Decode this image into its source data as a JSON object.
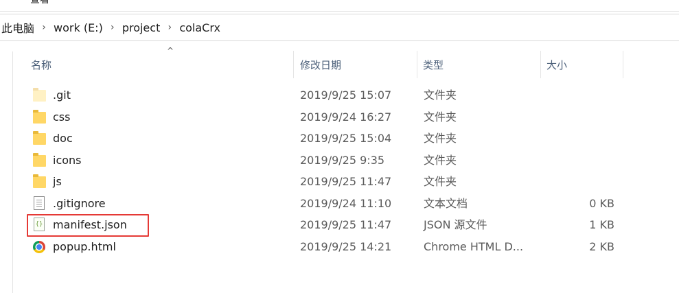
{
  "ribbon": {
    "tab_label": "查看"
  },
  "breadcrumb": {
    "items": [
      "此电脑",
      "work (E:)",
      "project",
      "colaCrx"
    ],
    "separator": "›"
  },
  "columns": {
    "name": "名称",
    "modified": "修改日期",
    "type": "类型",
    "size": "大小"
  },
  "files": [
    {
      "name": ".git",
      "modified": "2019/9/25 15:07",
      "type": "文件夹",
      "size": "",
      "icon": "folder-hidden-icon"
    },
    {
      "name": "css",
      "modified": "2019/9/24 16:27",
      "type": "文件夹",
      "size": "",
      "icon": "folder-icon"
    },
    {
      "name": "doc",
      "modified": "2019/9/25 15:04",
      "type": "文件夹",
      "size": "",
      "icon": "folder-icon"
    },
    {
      "name": "icons",
      "modified": "2019/9/25 9:35",
      "type": "文件夹",
      "size": "",
      "icon": "folder-icon"
    },
    {
      "name": "js",
      "modified": "2019/9/25 11:47",
      "type": "文件夹",
      "size": "",
      "icon": "folder-icon"
    },
    {
      "name": ".gitignore",
      "modified": "2019/9/24 11:10",
      "type": "文本文档",
      "size": "0 KB",
      "icon": "text-file-icon"
    },
    {
      "name": "manifest.json",
      "modified": "2019/9/25 11:47",
      "type": "JSON 源文件",
      "size": "1 KB",
      "icon": "json-file-icon"
    },
    {
      "name": "popup.html",
      "modified": "2019/9/25 14:21",
      "type": "Chrome HTML D...",
      "size": "2 KB",
      "icon": "chrome-icon"
    }
  ],
  "colors": {
    "header_text": "#4c607a",
    "highlight_border": "#e53935",
    "folder": "#ffd766"
  }
}
